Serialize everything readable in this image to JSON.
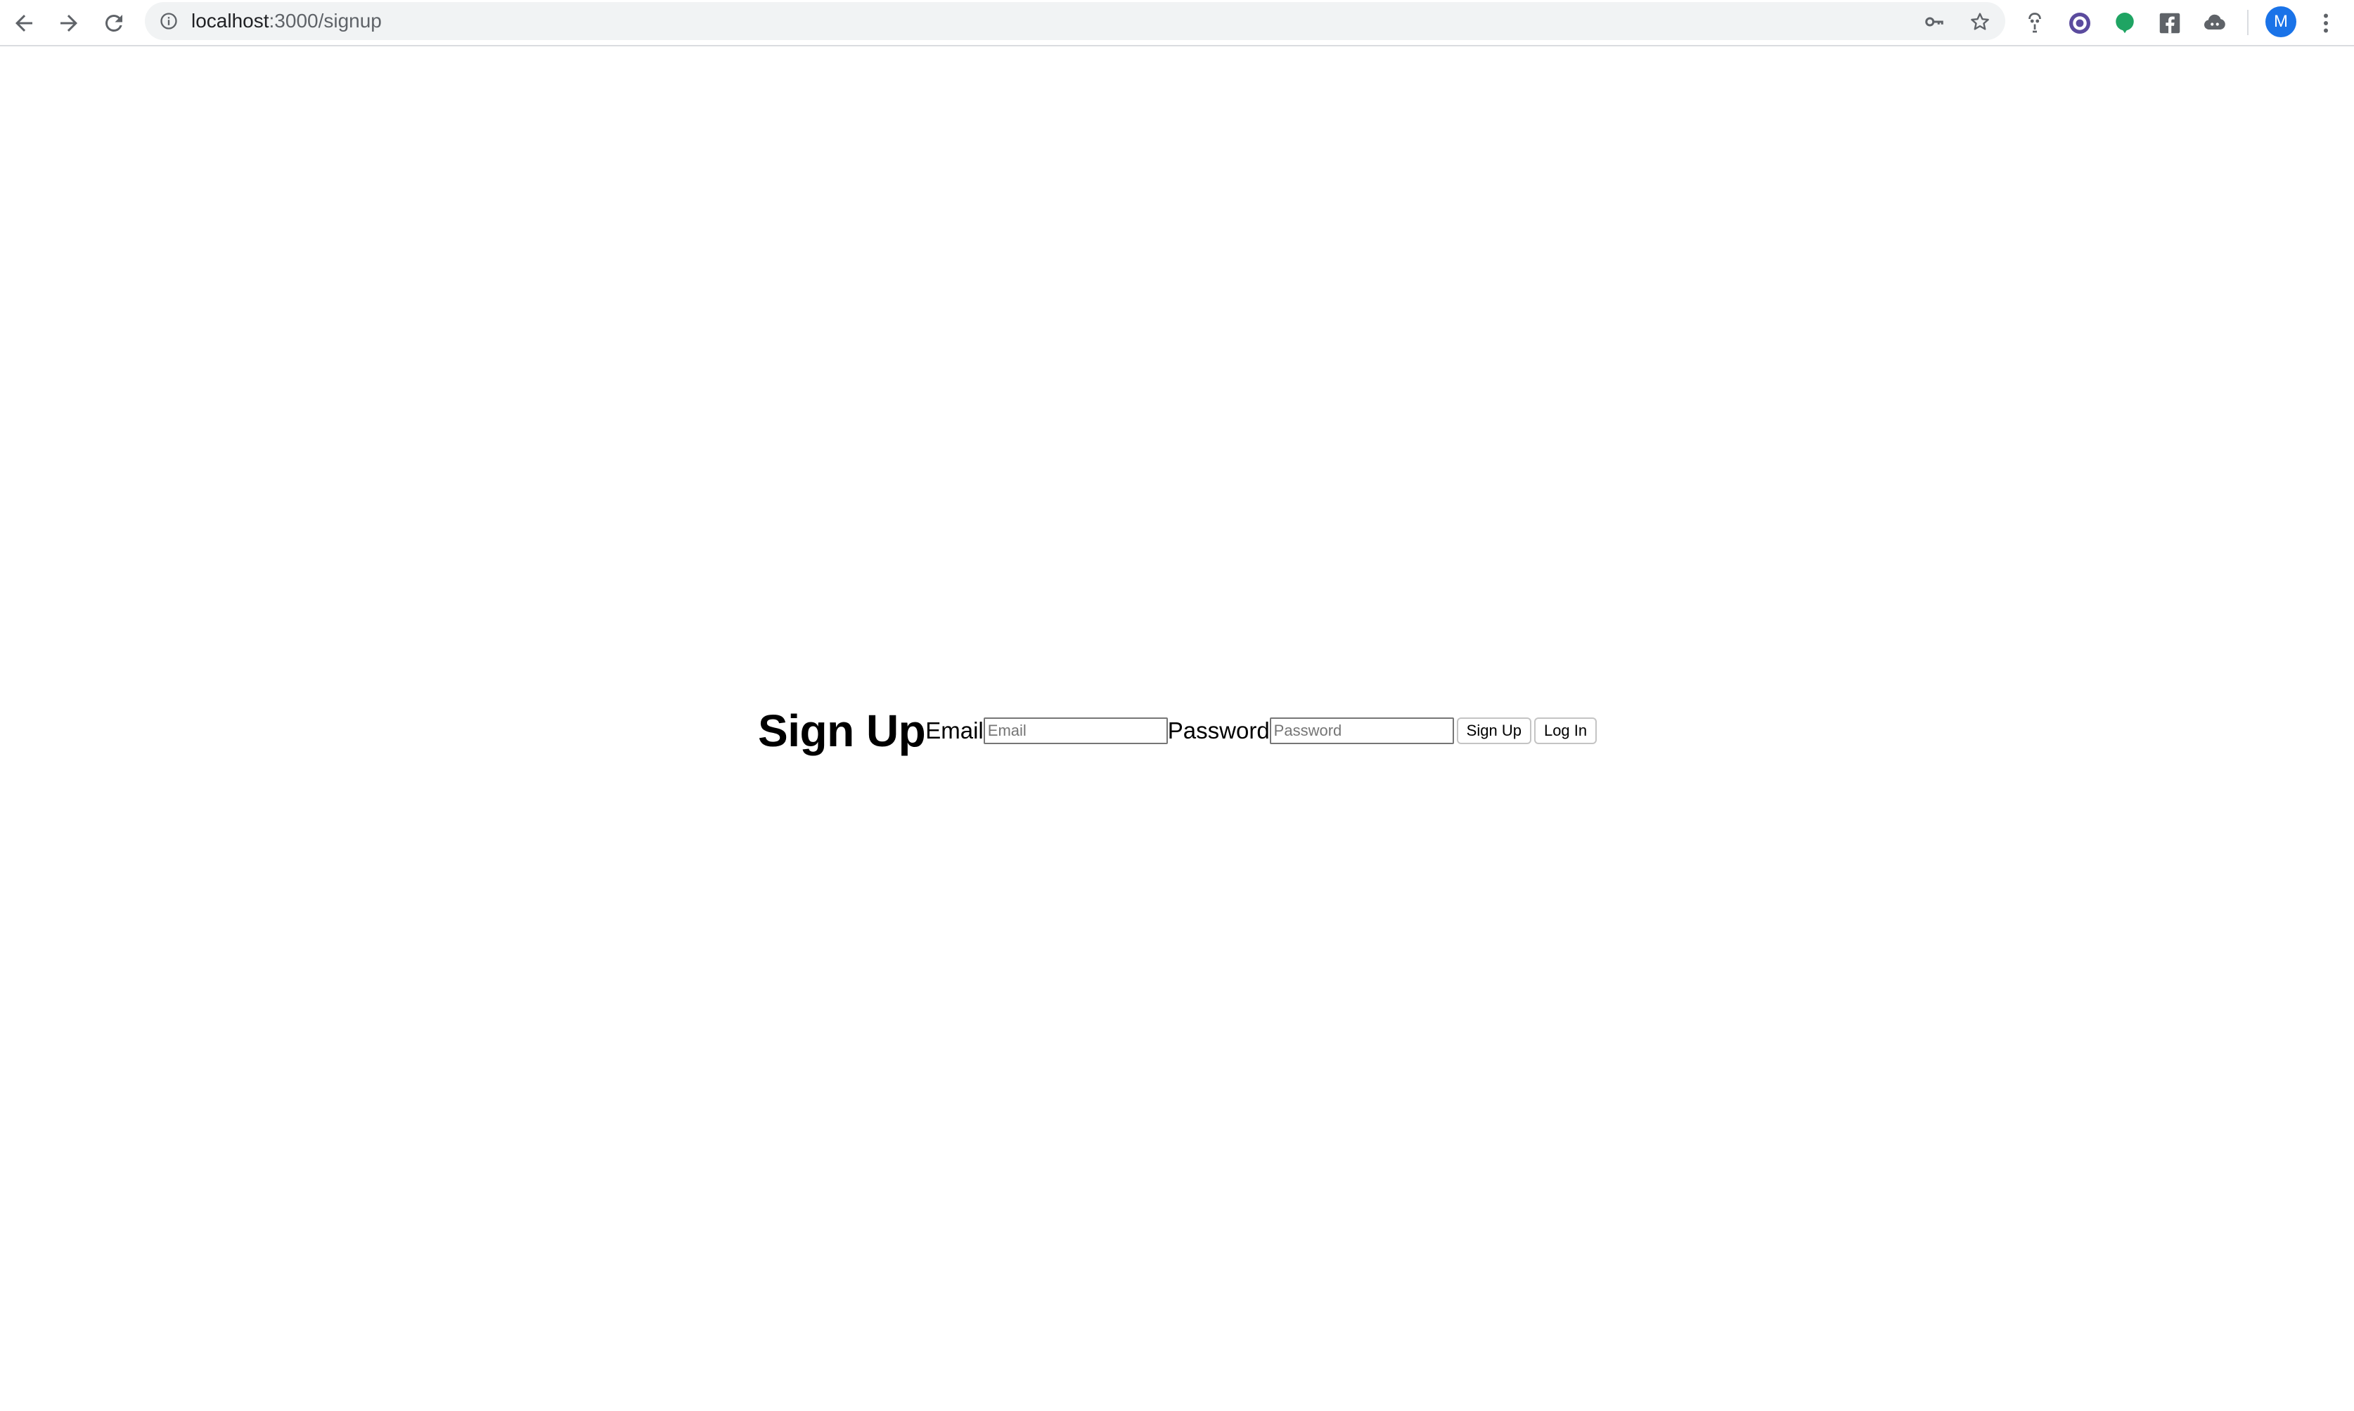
{
  "browser": {
    "url_host": "localhost",
    "url_path": ":3000/signup",
    "nav": {
      "back_icon": "arrow-left-icon",
      "forward_icon": "arrow-right-icon",
      "reload_icon": "reload-icon"
    },
    "omnibox_icons": [
      "info-icon",
      "key-icon",
      "star-icon"
    ],
    "extensions": [
      "spy-extension-icon",
      "purple-eye-extension-icon",
      "green-balloon-extension-icon",
      "facebook-extension-icon",
      "cloud-extension-icon"
    ],
    "profile_initial": "M",
    "accent_color": "#1a73e8"
  },
  "page": {
    "title": "Sign Up",
    "email_label": "Email",
    "email_placeholder": "Email",
    "password_label": "Password",
    "password_placeholder": "Password",
    "signup_button": "Sign Up",
    "login_button": "Log In"
  }
}
